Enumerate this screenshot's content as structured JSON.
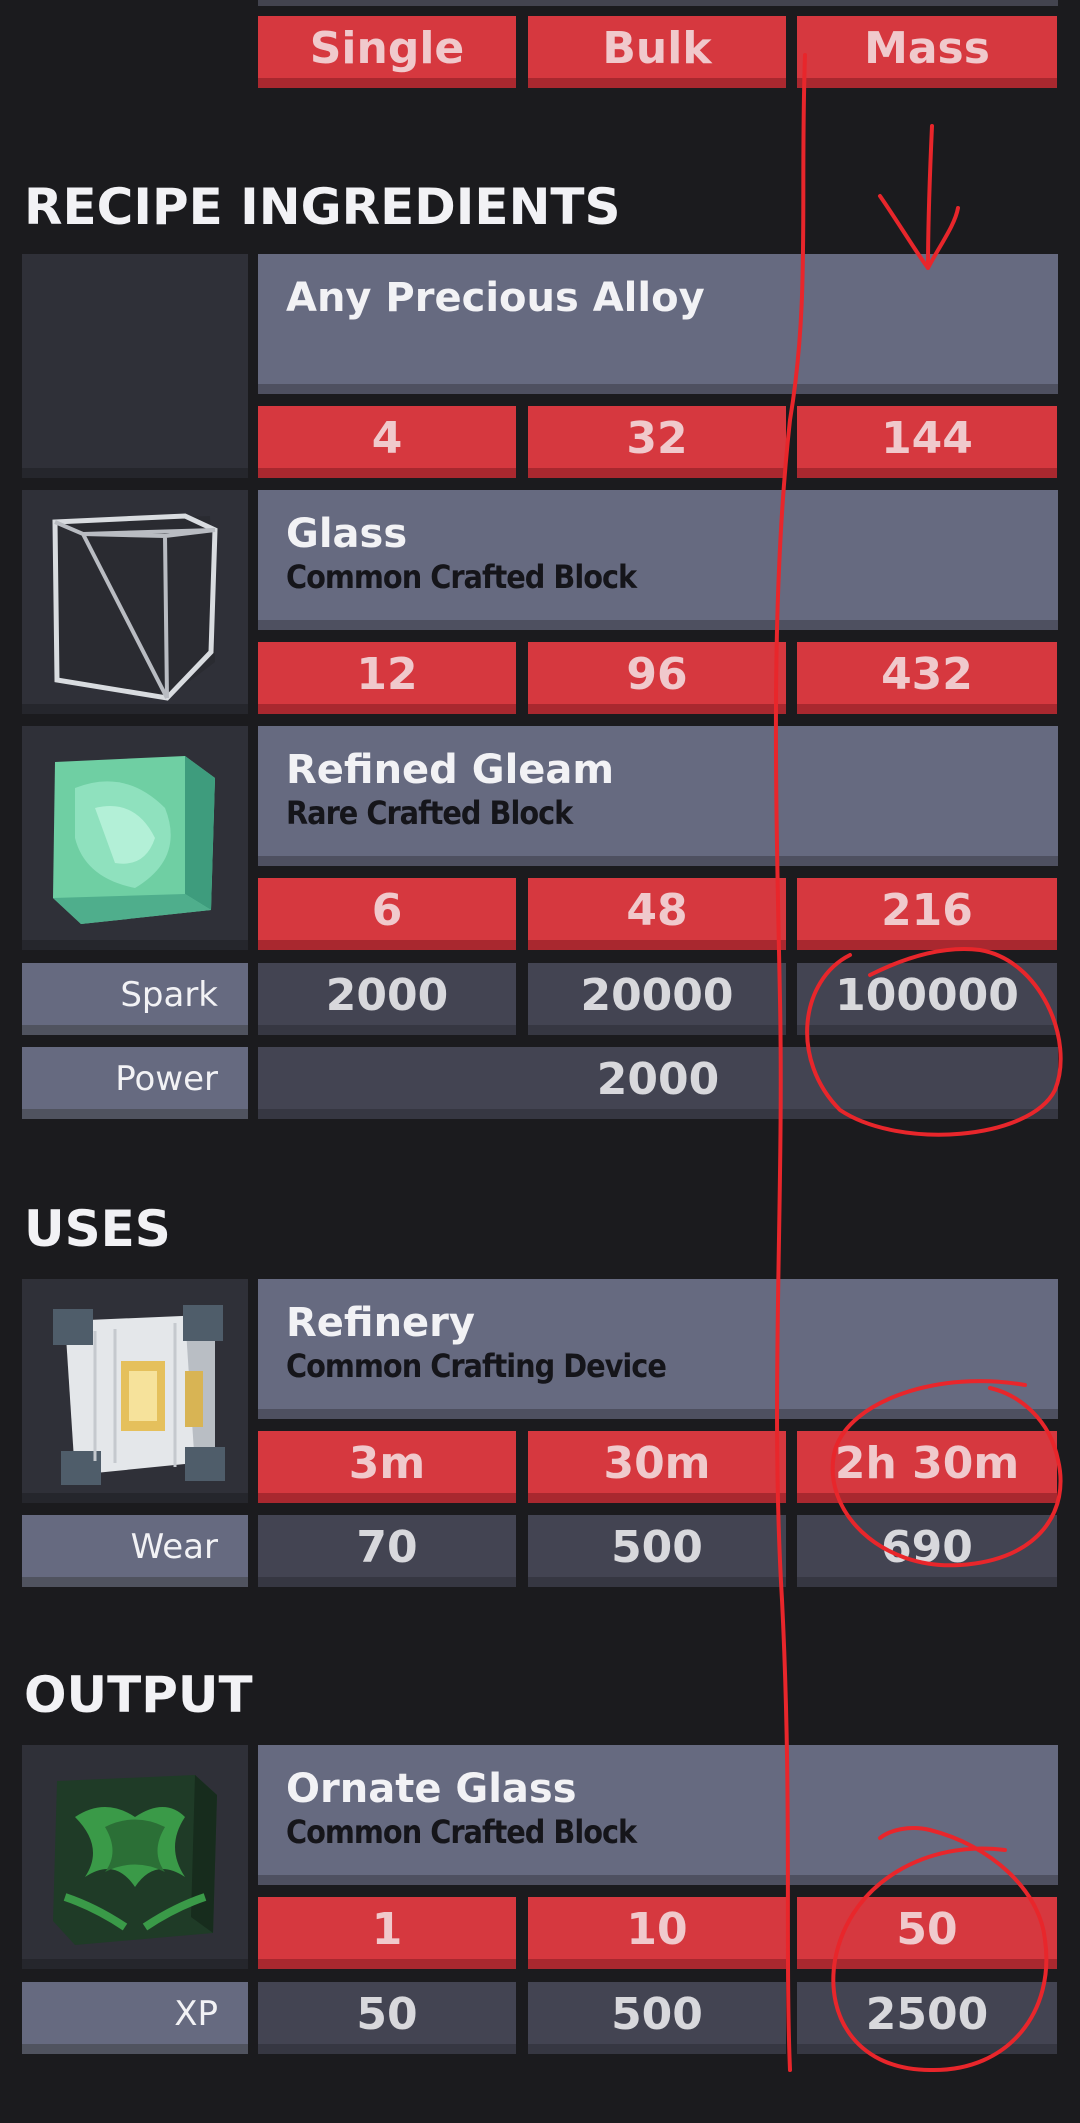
{
  "tabs": [
    "Single",
    "Bulk",
    "Mass"
  ],
  "sections": {
    "ingredients_title": "RECIPE INGREDIENTS",
    "uses_title": "USES",
    "output_title": "OUTPUT"
  },
  "ingredients": [
    {
      "name": "Any Precious Alloy",
      "subtitle": "",
      "icon": "empty-slot-icon",
      "qty": [
        "4",
        "32",
        "144"
      ]
    },
    {
      "name": "Glass",
      "subtitle": "Common Crafted Block",
      "icon": "glass-block-icon",
      "qty": [
        "12",
        "96",
        "432"
      ]
    },
    {
      "name": "Refined Gleam",
      "subtitle": "Rare Crafted Block",
      "icon": "gleam-block-icon",
      "qty": [
        "6",
        "48",
        "216"
      ]
    }
  ],
  "spark": {
    "label": "Spark",
    "values": [
      "2000",
      "20000",
      "100000"
    ]
  },
  "power": {
    "label": "Power",
    "value": "2000"
  },
  "uses": {
    "name": "Refinery",
    "subtitle": "Common Crafting Device",
    "icon": "refinery-icon",
    "times": [
      "3m",
      "30m",
      "2h 30m"
    ],
    "wear_label": "Wear",
    "wear": [
      "70",
      "500",
      "690"
    ]
  },
  "output": {
    "name": "Ornate Glass",
    "subtitle": "Common Crafted Block",
    "icon": "ornate-glass-icon",
    "qty": [
      "1",
      "10",
      "50"
    ],
    "xp_label": "XP",
    "xp": [
      "50",
      "500",
      "2500"
    ]
  },
  "colors": {
    "accent_red": "#d6383f",
    "panel": "#666a80",
    "dark_cell": "#434452",
    "annotation": "#e8262b"
  }
}
